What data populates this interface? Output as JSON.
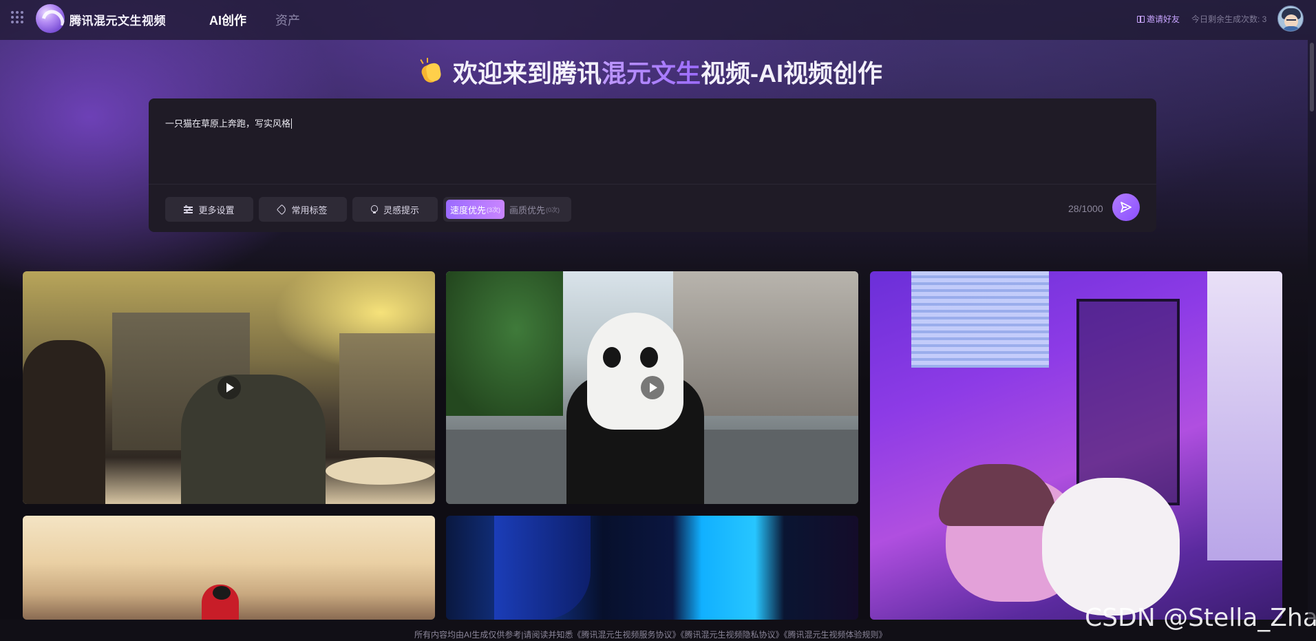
{
  "header": {
    "brand": "腾讯混元文生视频",
    "nav": [
      {
        "label": "AI创作",
        "active": true
      },
      {
        "label": "资产",
        "active": false
      }
    ],
    "invite_label": "邀请好友",
    "remaining_label": "今日剩余生成次数: 3"
  },
  "headline": {
    "prefix": "欢迎来到腾讯",
    "highlight": "混元文生",
    "suffix": "视频-AI视频创作"
  },
  "prompt": {
    "value": "一只猫在草原上奔跑，写实风格",
    "counter": "28/1000",
    "buttons": [
      {
        "label": "更多设置",
        "icon": "sliders-icon"
      },
      {
        "label": "常用标签",
        "icon": "tag-icon"
      },
      {
        "label": "灵感提示",
        "icon": "lightbulb-icon"
      }
    ],
    "priority": {
      "speed": {
        "label": "速度优先",
        "count": "(3次)",
        "selected": true
      },
      "quality": {
        "label": "画质优先",
        "count": "(0次)",
        "selected": false
      }
    }
  },
  "gallery": [
    {
      "name": "paris-cafe-video",
      "has_play": true
    },
    {
      "name": "panda-bicycle-video",
      "has_play": true
    },
    {
      "name": "girl-sleeping-purple-room-video",
      "has_play": false
    },
    {
      "name": "desert-penguin-video",
      "has_play": false
    },
    {
      "name": "blue-light-face-video",
      "has_play": false
    }
  ],
  "footer": {
    "notice": "所有内容均由AI生成仅供参考|请阅读并知悉",
    "links": [
      "《腾讯混元生视频服务协议》",
      "《腾讯混元生视频隐私协议》",
      "《腾讯混元生视频体验规则》"
    ]
  },
  "watermark": "CSDN @Stella_Zhan",
  "colors": {
    "accent": "#9b6bff",
    "background": "#0f0d14",
    "panel": "#1f1b26"
  }
}
